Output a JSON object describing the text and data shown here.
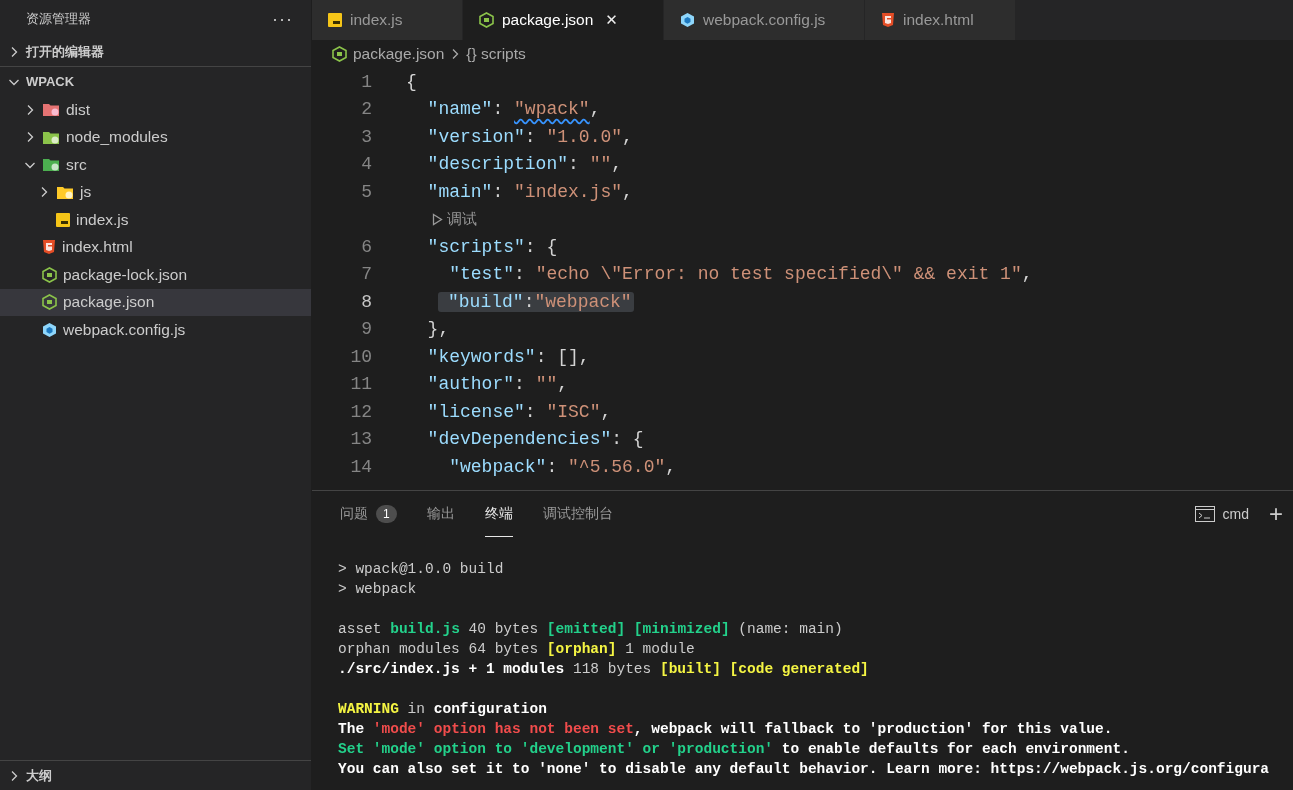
{
  "sidebar": {
    "title": "资源管理器",
    "more": "···",
    "open_editors": {
      "label": "打开的编辑器",
      "expanded": false
    },
    "project": {
      "label": "WPACK",
      "expanded": true
    },
    "tree": [
      {
        "name": "dist",
        "kind": "dist-folder",
        "expanded": false,
        "selected": false
      },
      {
        "name": "node_modules",
        "kind": "node-folder",
        "expanded": false,
        "selected": false
      },
      {
        "name": "src",
        "kind": "src-folder",
        "expanded": true,
        "selected": false,
        "children": [
          {
            "name": "js",
            "kind": "js-folder",
            "expanded": false,
            "selected": false
          },
          {
            "name": "index.js",
            "kind": "js-file",
            "selected": false
          }
        ]
      },
      {
        "name": "index.html",
        "kind": "html-file",
        "selected": false
      },
      {
        "name": "package-lock.json",
        "kind": "json-file",
        "selected": false
      },
      {
        "name": "package.json",
        "kind": "json-file",
        "selected": true
      },
      {
        "name": "webpack.config.js",
        "kind": "webpack-file",
        "selected": false
      }
    ],
    "outline": {
      "label": "大纲",
      "expanded": false
    }
  },
  "tabs": [
    {
      "label": "index.js",
      "kind": "js-file",
      "selected": false
    },
    {
      "label": "package.json",
      "kind": "json-file",
      "selected": true,
      "close": "✕"
    },
    {
      "label": "webpack.config.js",
      "kind": "webpack-file",
      "selected": false
    },
    {
      "label": "index.html",
      "kind": "html-file",
      "selected": false
    }
  ],
  "breadcrumb": [
    {
      "label": "package.json",
      "kind": "json-file"
    },
    {
      "label": "{} scripts",
      "kind": "symbol"
    }
  ],
  "editor": {
    "lines": [
      {
        "kind": "code",
        "number": "1",
        "highlighted": false,
        "tokens": [
          {
            "t": "{",
            "kind": "punct"
          }
        ]
      },
      {
        "kind": "code",
        "number": "2",
        "highlighted": false,
        "tokens": [
          {
            "t": "  \"name\"",
            "kind": "key"
          },
          {
            "t": ": ",
            "kind": "punct"
          },
          {
            "t": "\"wpack\"",
            "kind": "misspelled"
          },
          {
            "t": ",",
            "kind": "punct"
          }
        ]
      },
      {
        "kind": "code",
        "number": "3",
        "highlighted": false,
        "tokens": [
          {
            "t": "  \"version\"",
            "kind": "key"
          },
          {
            "t": ": ",
            "kind": "punct"
          },
          {
            "t": "\"1.0.0\"",
            "kind": "string"
          },
          {
            "t": ",",
            "kind": "punct"
          }
        ]
      },
      {
        "kind": "code",
        "number": "4",
        "highlighted": false,
        "tokens": [
          {
            "t": "  \"description\"",
            "kind": "key"
          },
          {
            "t": ": ",
            "kind": "punct"
          },
          {
            "t": "\"\"",
            "kind": "string"
          },
          {
            "t": ",",
            "kind": "punct"
          }
        ]
      },
      {
        "kind": "code",
        "number": "5",
        "highlighted": false,
        "tokens": [
          {
            "t": "  \"main\"",
            "kind": "key"
          },
          {
            "t": ": ",
            "kind": "punct"
          },
          {
            "t": "\"index.js\"",
            "kind": "string"
          },
          {
            "t": ",",
            "kind": "punct"
          }
        ]
      },
      {
        "kind": "codelens",
        "text": "调试"
      },
      {
        "kind": "code",
        "number": "6",
        "highlighted": false,
        "tokens": [
          {
            "t": "  \"scripts\"",
            "kind": "key"
          },
          {
            "t": ": {",
            "kind": "punct"
          }
        ]
      },
      {
        "kind": "code",
        "number": "7",
        "highlighted": false,
        "tokens": [
          {
            "t": "    \"test\"",
            "kind": "key"
          },
          {
            "t": ": ",
            "kind": "punct"
          },
          {
            "t": "\"echo \\\"Error: no test specified\\\" && exit 1\"",
            "kind": "string"
          },
          {
            "t": ",",
            "kind": "punct"
          }
        ]
      },
      {
        "kind": "code",
        "number": "8",
        "highlighted": true,
        "tokens": [
          {
            "t": "\"build\"",
            "kind": "key"
          },
          {
            "t": ":",
            "kind": "punct"
          },
          {
            "t": "\"webpack\"",
            "kind": "string"
          }
        ]
      },
      {
        "kind": "code",
        "number": "9",
        "highlighted": false,
        "tokens": [
          {
            "t": "  },",
            "kind": "punct"
          }
        ]
      },
      {
        "kind": "code",
        "number": "10",
        "highlighted": false,
        "tokens": [
          {
            "t": "  \"keywords\"",
            "kind": "key"
          },
          {
            "t": ": [],",
            "kind": "punct"
          }
        ]
      },
      {
        "kind": "code",
        "number": "11",
        "highlighted": false,
        "tokens": [
          {
            "t": "  \"author\"",
            "kind": "key"
          },
          {
            "t": ": ",
            "kind": "punct"
          },
          {
            "t": "\"\"",
            "kind": "string"
          },
          {
            "t": ",",
            "kind": "punct"
          }
        ]
      },
      {
        "kind": "code",
        "number": "12",
        "highlighted": false,
        "tokens": [
          {
            "t": "  \"license\"",
            "kind": "key"
          },
          {
            "t": ": ",
            "kind": "punct"
          },
          {
            "t": "\"ISC\"",
            "kind": "string"
          },
          {
            "t": ",",
            "kind": "punct"
          }
        ]
      },
      {
        "kind": "code",
        "number": "13",
        "highlighted": false,
        "tokens": [
          {
            "t": "  \"devDependencies\"",
            "kind": "key"
          },
          {
            "t": ": {",
            "kind": "punct"
          }
        ]
      },
      {
        "kind": "code",
        "number": "14",
        "highlighted": false,
        "tokens": [
          {
            "t": "    \"webpack\"",
            "kind": "key"
          },
          {
            "t": ": ",
            "kind": "punct"
          },
          {
            "t": "\"^5.56.0\"",
            "kind": "string"
          },
          {
            "t": ",",
            "kind": "punct"
          }
        ]
      }
    ]
  },
  "panel": {
    "tabs": [
      {
        "label": "问题",
        "selected": false,
        "badge": "1"
      },
      {
        "label": "输出",
        "selected": false
      },
      {
        "label": "终端",
        "selected": true
      },
      {
        "label": "调试控制台",
        "selected": false
      }
    ],
    "shell": "cmd",
    "add": "+",
    "terminal": [
      [
        [
          {
            "t": "> wpack@1.0.0 build",
            "kind": "plain"
          }
        ],
        [
          {
            "t": "> webpack",
            "kind": "plain"
          }
        ]
      ],
      [
        [
          {
            "t": "asset ",
            "kind": "plain"
          },
          {
            "t": "build.js",
            "kind": "green-bold"
          },
          {
            "t": " 40 bytes ",
            "kind": "plain"
          },
          {
            "t": "[emitted] [minimized]",
            "kind": "green-bold"
          },
          {
            "t": " (name: main)",
            "kind": "plain"
          }
        ],
        [
          {
            "t": "orphan modules 64 bytes ",
            "kind": "plain"
          },
          {
            "t": "[orphan]",
            "kind": "yellow-bold"
          },
          {
            "t": " 1 module",
            "kind": "plain"
          }
        ],
        [
          {
            "t": "./src/index.js + 1 modules",
            "kind": "bold"
          },
          {
            "t": " 118 bytes ",
            "kind": "plain"
          },
          {
            "t": "[built] [code generated]",
            "kind": "yellow-bold"
          }
        ]
      ],
      [
        [
          {
            "t": "WARNING",
            "kind": "yellow-bold"
          },
          {
            "t": " in ",
            "kind": "plain"
          },
          {
            "t": "configuration",
            "kind": "bold"
          }
        ],
        [
          {
            "t": "The ",
            "kind": "bold"
          },
          {
            "t": "'mode' option has not been set",
            "kind": "red"
          },
          {
            "t": ", webpack will fallback to 'production' for this value.",
            "kind": "bold"
          }
        ],
        [
          {
            "t": "Set 'mode' option to 'development' or 'production'",
            "kind": "green-bold"
          },
          {
            "t": " to enable defaults for each environment.",
            "kind": "bold"
          }
        ],
        [
          {
            "t": "You can also set it to 'none' to disable any default behavior. Learn more: https://webpack.js.org/configura",
            "kind": "bold"
          }
        ]
      ]
    ]
  }
}
